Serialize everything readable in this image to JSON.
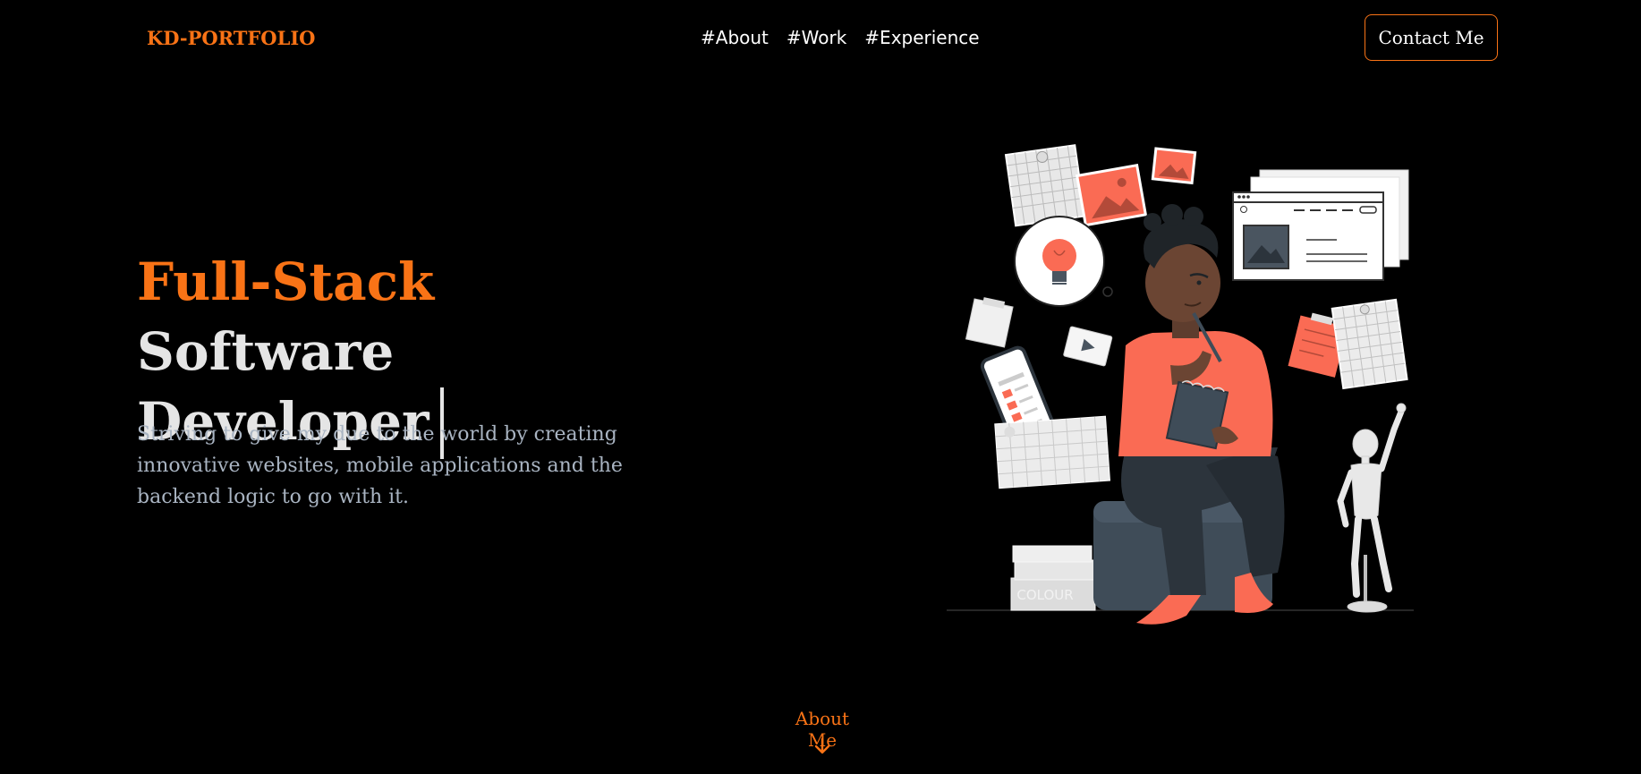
{
  "header": {
    "logo": "KD-PORTFOLIO",
    "nav": [
      {
        "label": "#About"
      },
      {
        "label": "#Work"
      },
      {
        "label": "#Experience"
      }
    ],
    "contact_label": "Contact Me"
  },
  "hero": {
    "title_accent": "Full-Stack",
    "title_rest": "Software",
    "title_line2": "Developer",
    "description": "Striving to give my due to the world by creating innovative websites, mobile applications and the backend logic to go with it.",
    "illustration_label": "COLOUR"
  },
  "about_link": {
    "label": "About Me",
    "icon": "arrow-down-icon"
  },
  "colors": {
    "accent": "#f97316",
    "background": "#000000",
    "text": "#e5e5e5",
    "muted": "#a9b4c2",
    "illustration_coral": "#fa6b54"
  }
}
